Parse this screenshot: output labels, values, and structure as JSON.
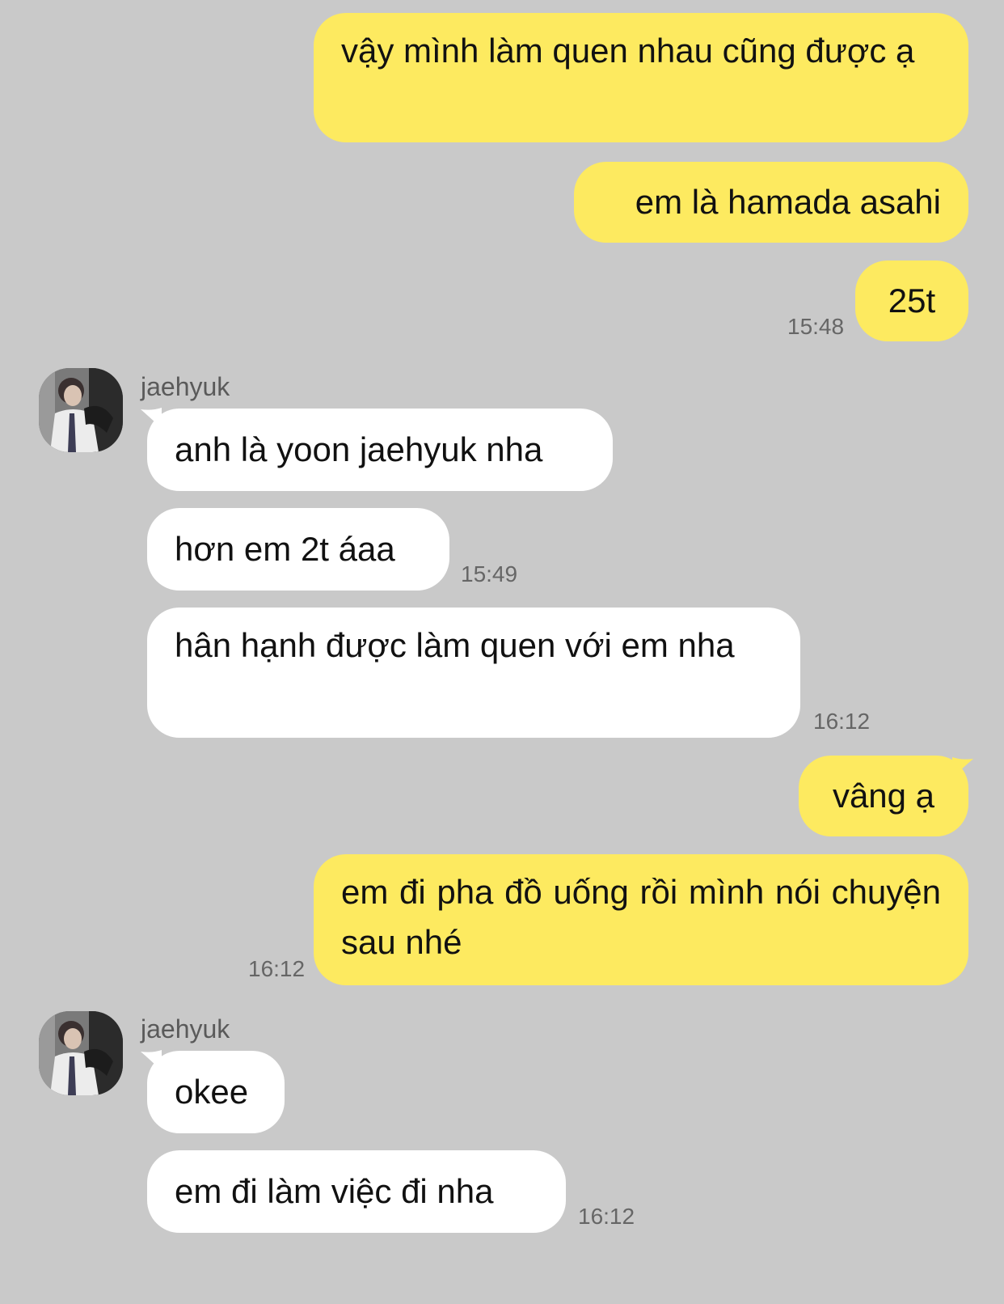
{
  "chat": {
    "contact_name": "jaehyuk",
    "messages": [
      {
        "sender": "me",
        "text": "vậy mình làm quen nhau cũng được ạ"
      },
      {
        "sender": "me",
        "text": "em là hamada asahi"
      },
      {
        "sender": "me",
        "text": "25t",
        "time": "15:48"
      },
      {
        "sender": "jaehyuk",
        "text": "anh là yoon jaehyuk nha"
      },
      {
        "sender": "jaehyuk",
        "text": "hơn em 2t áaa",
        "time": "15:49"
      },
      {
        "sender": "jaehyuk",
        "text": "hân hạnh được làm quen với em nha",
        "time": "16:12"
      },
      {
        "sender": "me",
        "text": "vâng ạ"
      },
      {
        "sender": "me",
        "text": "em đi pha đồ uống rồi mình nói chuyện sau nhé",
        "time": "16:12"
      },
      {
        "sender": "jaehyuk",
        "text": "okee"
      },
      {
        "sender": "jaehyuk",
        "text": "em đi làm việc đi nha",
        "time": "16:12"
      }
    ]
  },
  "colors": {
    "background": "#c9c9c9",
    "my_bubble": "#fdea60",
    "their_bubble": "#ffffff",
    "timestamp": "#666666"
  }
}
